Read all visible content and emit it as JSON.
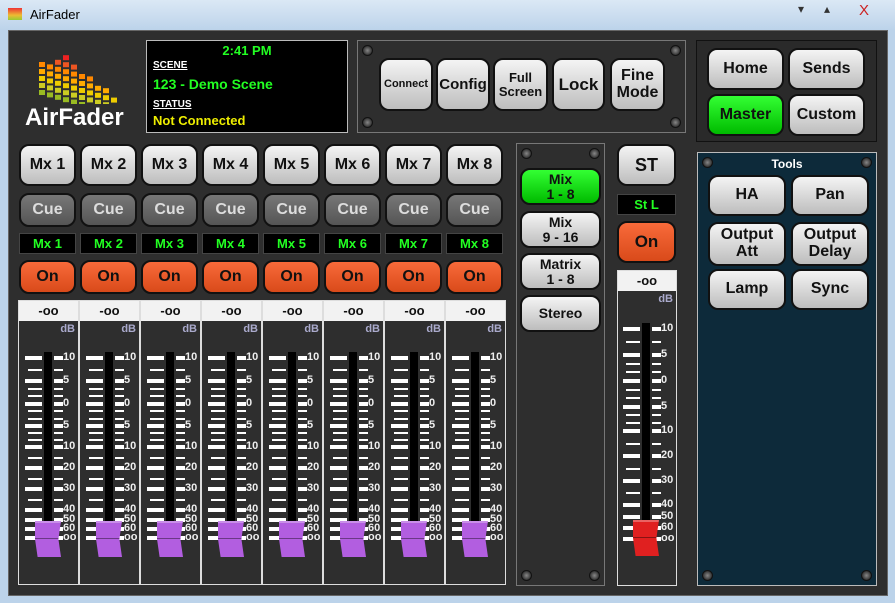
{
  "window": {
    "title": "AirFader",
    "minimize": "▾",
    "maximize": "▴",
    "close": "X"
  },
  "logo": {
    "text": "AirFader"
  },
  "info": {
    "time": "2:41 PM",
    "scene_label": "SCENE",
    "scene": "123 - Demo Scene",
    "status_label": "STATUS",
    "status": "Not Connected"
  },
  "toolbar": [
    {
      "label": "Connect"
    },
    {
      "label": "Config"
    },
    {
      "label": "Full\nScreen"
    },
    {
      "label": "Lock"
    },
    {
      "label": "Fine\nMode"
    }
  ],
  "nav": {
    "home": "Home",
    "sends": "Sends",
    "master": "Master",
    "custom": "Custom",
    "active": "Master"
  },
  "channels": [
    {
      "name": "Mx 1",
      "cue": "Cue",
      "label": "Mx 1",
      "on": "On",
      "level": "-oo"
    },
    {
      "name": "Mx 2",
      "cue": "Cue",
      "label": "Mx 2",
      "on": "On",
      "level": "-oo"
    },
    {
      "name": "Mx 3",
      "cue": "Cue",
      "label": "Mx 3",
      "on": "On",
      "level": "-oo"
    },
    {
      "name": "Mx 4",
      "cue": "Cue",
      "label": "Mx 4",
      "on": "On",
      "level": "-oo"
    },
    {
      "name": "Mx 5",
      "cue": "Cue",
      "label": "Mx 5",
      "on": "On",
      "level": "-oo"
    },
    {
      "name": "Mx 6",
      "cue": "Cue",
      "label": "Mx 6",
      "on": "On",
      "level": "-oo"
    },
    {
      "name": "Mx 7",
      "cue": "Cue",
      "label": "Mx 7",
      "on": "On",
      "level": "-oo"
    },
    {
      "name": "Mx 8",
      "cue": "Cue",
      "label": "Mx 8",
      "on": "On",
      "level": "-oo"
    }
  ],
  "scale": {
    "unit": "dB",
    "labels": [
      "10",
      "5",
      "0",
      "5",
      "10",
      "20",
      "30",
      "40",
      "50",
      "60",
      "oo"
    ]
  },
  "mix_select": [
    {
      "label": "Mix\n1 - 8",
      "active": true
    },
    {
      "label": "Mix\n9 - 16",
      "active": false
    },
    {
      "label": "Matrix\n1 - 8",
      "active": false
    },
    {
      "label": "Stereo",
      "active": false
    }
  ],
  "master": {
    "name": "ST",
    "label": "St L",
    "on": "On",
    "level": "-oo"
  },
  "tools": {
    "title": "Tools",
    "buttons": [
      "HA",
      "Pan",
      "Output\nAtt",
      "Output\nDelay",
      "Lamp",
      "Sync"
    ]
  },
  "colors": {
    "active_green": "#11cc11",
    "on_orange": "#e8582a",
    "fader_cap": "#b25ee0",
    "master_cap": "#e02020",
    "tools_bg": "#0d2a3a"
  }
}
